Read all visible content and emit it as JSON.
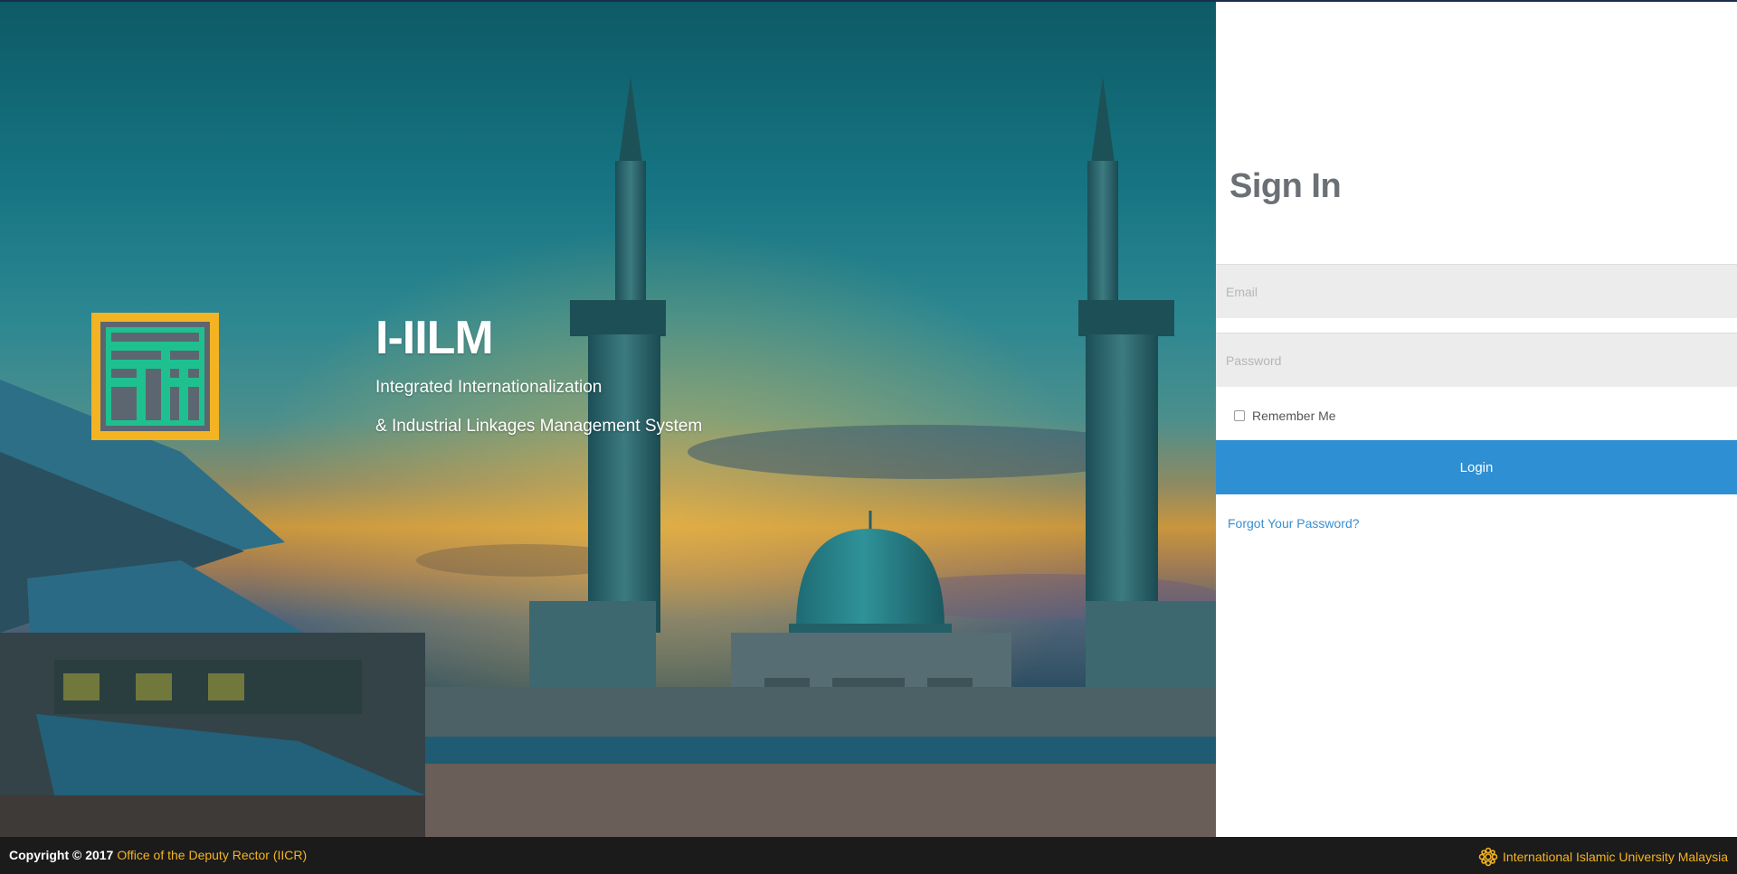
{
  "brand": {
    "title": "I-IILM",
    "line1": "Integrated Internationalization",
    "line2": "& Industrial Linkages Management System",
    "logo_color": "#f3b323",
    "logo_inner_color": "#1fc08f"
  },
  "signin": {
    "title": "Sign In",
    "email_placeholder": "Email",
    "password_placeholder": "Password",
    "remember_label": "Remember Me",
    "login_label": "Login",
    "forgot_label": "Forgot Your Password?",
    "button_color": "#2e8fd2"
  },
  "footer": {
    "copyright": "Copyright © 2017",
    "office_link": "Office of the Deputy Rector (IICR)",
    "university_link": "International Islamic University Malaysia",
    "link_color": "#f3b323"
  }
}
